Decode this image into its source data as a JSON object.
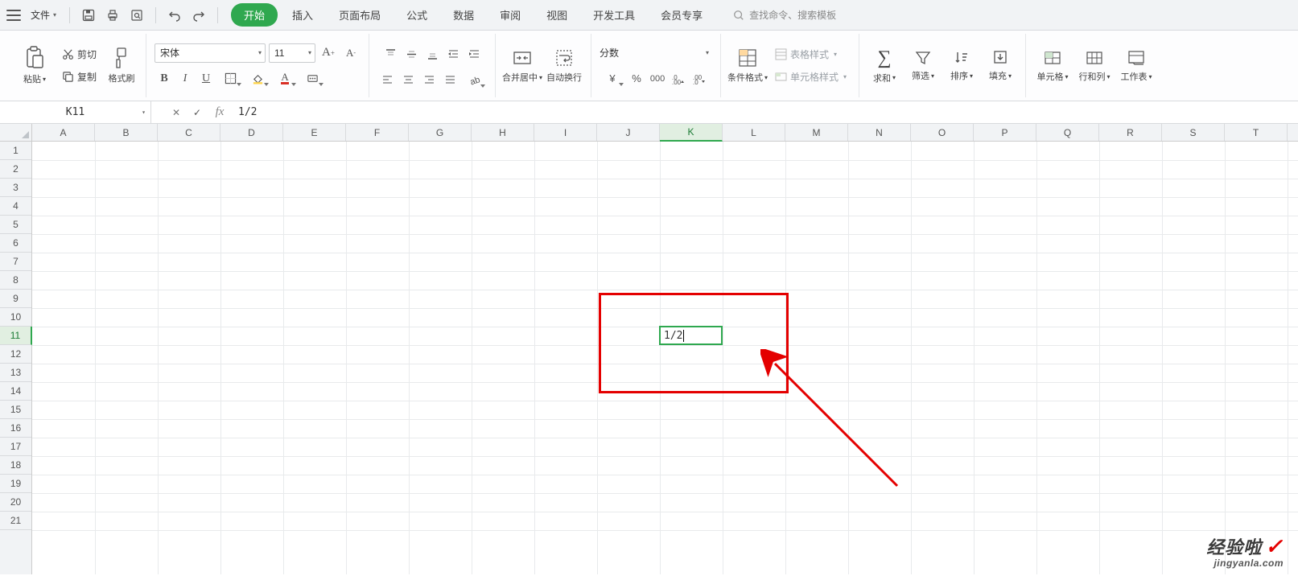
{
  "qat": {
    "file_label": "文件"
  },
  "tabs": {
    "items": [
      "开始",
      "插入",
      "页面布局",
      "公式",
      "数据",
      "审阅",
      "视图",
      "开发工具",
      "会员专享"
    ],
    "active": 0,
    "search_placeholder": "查找命令、搜索模板"
  },
  "ribbon": {
    "paste": "粘贴",
    "cut": "剪切",
    "copy": "复制",
    "fmtpainter": "格式刷",
    "font_name": "宋体",
    "font_size": "11",
    "merge": "合并居中",
    "wrap": "自动换行",
    "number_format": "分数",
    "cond_fmt": "条件格式",
    "table_style": "表格样式",
    "cell_style": "单元格样式",
    "sum": "求和",
    "filter": "筛选",
    "sort": "排序",
    "fill": "填充",
    "cells": "单元格",
    "rowscols": "行和列",
    "worksheet": "工作表"
  },
  "namebox": {
    "ref": "K11",
    "formula": "1/2"
  },
  "cell": {
    "value": "1/2"
  },
  "columns": [
    "A",
    "B",
    "C",
    "D",
    "E",
    "F",
    "G",
    "H",
    "I",
    "J",
    "K",
    "L",
    "M",
    "N",
    "O",
    "P",
    "Q",
    "R",
    "S",
    "T"
  ],
  "rows": [
    "1",
    "2",
    "3",
    "4",
    "5",
    "6",
    "7",
    "8",
    "9",
    "10",
    "11",
    "12",
    "13",
    "14",
    "15",
    "16",
    "17",
    "18",
    "19",
    "20",
    "21"
  ],
  "selected_col": 10,
  "selected_row": 10,
  "watermark": {
    "t1": "经验啦",
    "t2": "jingyanla.com"
  }
}
